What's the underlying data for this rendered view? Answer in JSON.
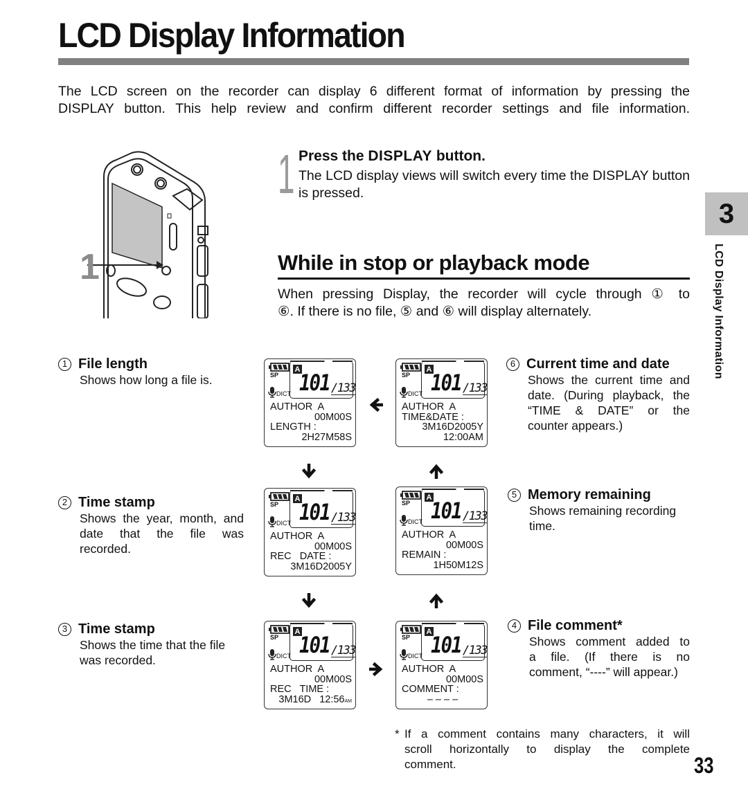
{
  "page": {
    "title": "LCD Display Information",
    "intro": [
      "The LCD screen on the recorder can display 6 different format of information by pressing the",
      "DISPLAY button. This help review and confirm different recorder settings and file information."
    ],
    "chapter_number": "3",
    "chapter_label": "LCD Display Information",
    "page_number": "33"
  },
  "illustration": {
    "step_callout": "1"
  },
  "step1": {
    "number": "1",
    "heading_prefix": "Press the ",
    "heading_strong": "DISPLAY",
    "heading_suffix": " button.",
    "body": "The LCD display views will switch every time the DISPLAY button is pressed."
  },
  "section": {
    "title": "While in stop or playback mode",
    "body_line1": "When pressing Display, the recorder will cycle through ① to",
    "body_line2": "⑥. If there is no file, ⑤ and ⑥ will display alternately."
  },
  "descriptions": [
    {
      "num": "1",
      "title": "File length",
      "lines": [
        "Shows how long a file is."
      ]
    },
    {
      "num": "2",
      "title": "Time stamp",
      "lines": [
        "Shows the year, month, and",
        "date that the file was",
        "recorded."
      ]
    },
    {
      "num": "3",
      "title": "Time stamp",
      "lines": [
        "Shows the time that the file",
        "was recorded."
      ]
    },
    {
      "num": "6",
      "title": "Current time and date",
      "lines": [
        "Shows the current time and",
        "date. (During playback, the",
        "“TIME & DATE” or the",
        "counter appears.)"
      ]
    },
    {
      "num": "5",
      "title": "Memory remaining",
      "lines": [
        "Shows remaining recording",
        "time."
      ]
    },
    {
      "num": "4",
      "title": "File comment*",
      "lines": [
        "Shows comment added to",
        "a file. (If there is no",
        "comment, “----” will appear.)"
      ]
    }
  ],
  "lcd_common": {
    "mode": "SP",
    "folder": "A",
    "mic_mode": "DICT",
    "file_number": "101",
    "total_files": "/133",
    "author": "AUTHOR  A",
    "counter": "00M00S",
    "battery": "full"
  },
  "lcd_screens": [
    {
      "id": "1",
      "label": "LENGTH :",
      "value": "2H27M58S"
    },
    {
      "id": "6",
      "label": "TIME&DATE :",
      "value": "3M16D2005Y",
      "value2": "12:00AM",
      "counter_hidden": true
    },
    {
      "id": "2",
      "label": "REC   DATE :",
      "value": "3M16D2005Y"
    },
    {
      "id": "5",
      "label": "REMAIN :",
      "value": "1H50M12S"
    },
    {
      "id": "3",
      "label": "REC   TIME :",
      "value": "3M16D   12:56",
      "ampm": "AM"
    },
    {
      "id": "4",
      "label": "COMMENT :",
      "value": "– – – –"
    }
  ],
  "flow_arrows": [
    "left",
    "down",
    "up",
    "down",
    "up",
    "right"
  ],
  "footnote": {
    "marker": "*",
    "lines": [
      "If a comment contains many characters, it will",
      "scroll horizontally to display the complete",
      "comment."
    ]
  }
}
